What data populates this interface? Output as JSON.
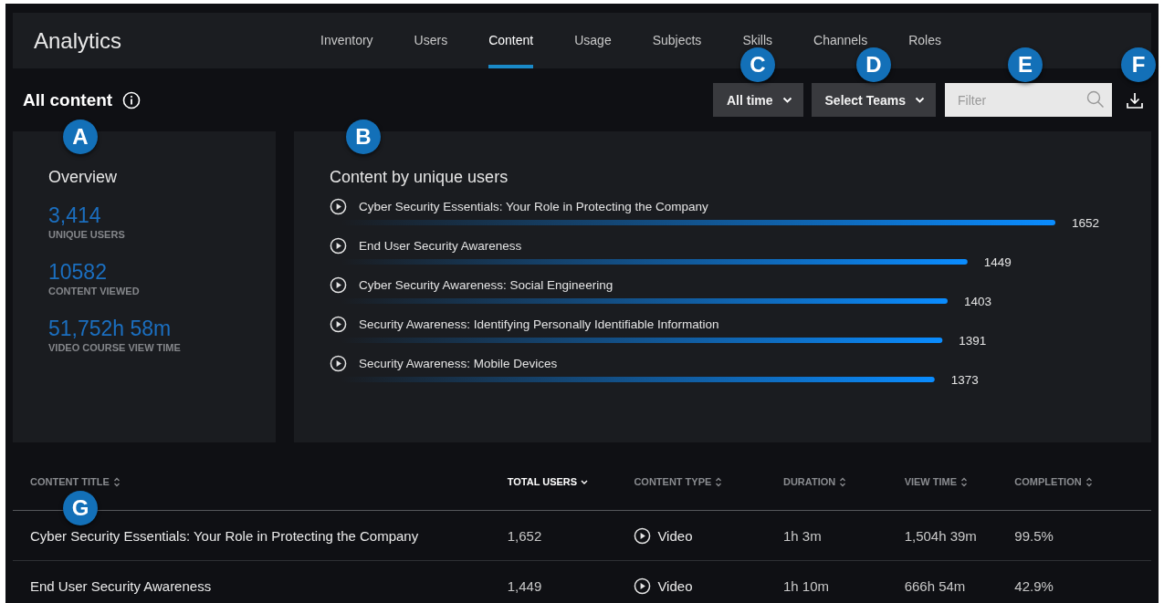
{
  "app_title": "Analytics",
  "nav_tabs": [
    {
      "label": "Inventory",
      "selected": false
    },
    {
      "label": "Users",
      "selected": false
    },
    {
      "label": "Content",
      "selected": true
    },
    {
      "label": "Usage",
      "selected": false
    },
    {
      "label": "Subjects",
      "selected": false
    },
    {
      "label": "Skills",
      "selected": false
    },
    {
      "label": "Channels",
      "selected": false
    },
    {
      "label": "Roles",
      "selected": false
    }
  ],
  "page_title": "All content",
  "toolbar": {
    "time_dropdown": "All time",
    "teams_dropdown": "Select Teams",
    "filter": {
      "placeholder": "Filter"
    }
  },
  "overview": {
    "title": "Overview",
    "stats": [
      {
        "value": "3,414",
        "label": "UNIQUE USERS"
      },
      {
        "value": "10582",
        "label": "CONTENT VIEWED"
      },
      {
        "value": "51,752h 58m",
        "label": "VIDEO COURSE VIEW TIME"
      }
    ]
  },
  "content_chart": {
    "chart_data": {
      "type": "bar",
      "orientation": "horizontal",
      "title": "Content by unique users",
      "categories": [
        "Cyber Security Essentials: Your Role in Protecting the Company",
        "End User Security Awareness",
        "Cyber Security Awareness: Social Engineering",
        "Security Awareness: Identifying Personally Identifiable Information",
        "Security Awareness: Mobile Devices"
      ],
      "series": [
        {
          "color": "#0a8cff",
          "values": [
            1652,
            1449,
            1403,
            1391,
            1373
          ]
        }
      ],
      "data_labels": true
    }
  },
  "table": {
    "columns": [
      {
        "label": "CONTENT TITLE",
        "active": false
      },
      {
        "label": "TOTAL USERS",
        "active": true
      },
      {
        "label": "CONTENT TYPE",
        "active": false
      },
      {
        "label": "DURATION",
        "active": false
      },
      {
        "label": "VIEW TIME",
        "active": false
      },
      {
        "label": "COMPLETION",
        "active": false
      }
    ],
    "rows": [
      {
        "title": "Cyber Security Essentials: Your Role in Protecting the Company",
        "total_users": "1,652",
        "content_type": {
          "kind": "video",
          "label": "Video"
        },
        "duration": "1h 3m",
        "view_time": "1,504h 39m",
        "completion": "99.5%"
      },
      {
        "title": "End User Security Awareness",
        "total_users": "1,449",
        "content_type": {
          "kind": "video",
          "label": "Video"
        },
        "duration": "1h 10m",
        "view_time": "666h 54m",
        "completion": "42.9%"
      }
    ]
  },
  "callouts": [
    {
      "letter": "A"
    },
    {
      "letter": "B"
    },
    {
      "letter": "C"
    },
    {
      "letter": "D"
    },
    {
      "letter": "E"
    },
    {
      "letter": "F"
    },
    {
      "letter": "G"
    }
  ]
}
